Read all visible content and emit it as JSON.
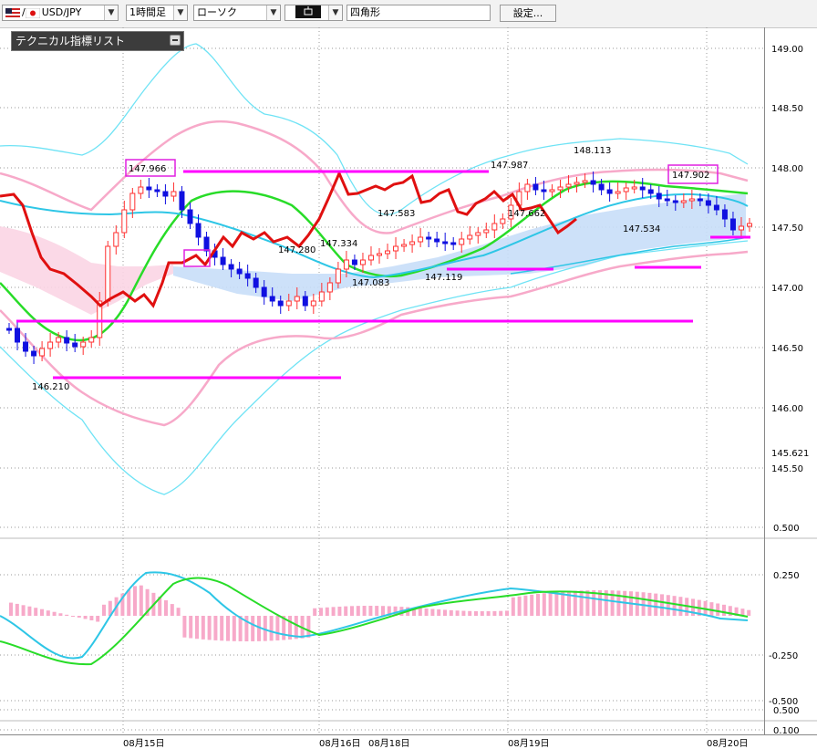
{
  "toolbar": {
    "symbol": "USD/JPY",
    "timeframe": "1時間足",
    "chart_type": "ローソク",
    "draw_tool_icon": "rectangle-icon",
    "shape_name": "四角形",
    "settings_label": "設定..."
  },
  "indicator_list": {
    "title": "テクニカル指標リスト"
  },
  "price_axis": {
    "labels": [
      "149.00",
      "148.50",
      "148.00",
      "147.50",
      "147.00",
      "146.50",
      "146.00",
      "145.621",
      "145.50"
    ]
  },
  "macd_axis": {
    "labels": [
      "0.500",
      "0.250",
      "-0.250",
      "-0.500",
      "0.500",
      "0.100"
    ]
  },
  "time_axis": {
    "labels": [
      "08月15日",
      "08月16日",
      "08月18日",
      "08月19日",
      "08月20日"
    ]
  },
  "annotations": {
    "labels": [
      "147.966",
      "146.210",
      "147.280",
      "147.334",
      "147.083",
      "147.583",
      "147.119",
      "147.987",
      "147.662",
      "148.113",
      "147.534",
      "147.902"
    ]
  },
  "colors": {
    "bollinger_outer": "#6fe3f5",
    "bollinger_inner": "#f7a9c9",
    "moving_average": "#28dc28",
    "kijun": "#2ec6e6",
    "chikou": "#e01010",
    "cloud": "#c8def8",
    "cloud_pink": "#fbd5e4",
    "candle_up": "#ff3030",
    "candle_down": "#1010e0",
    "levels": "#ff00ff"
  },
  "chart_data": {
    "type": "candlestick",
    "symbol": "USD/JPY",
    "timeframe": "1時間足",
    "price_ylim": [
      145.5,
      149.0
    ],
    "macd_ylim": [
      -0.5,
      0.5
    ],
    "categories": [
      "08月15日",
      "08月16日",
      "08月18日",
      "08月19日",
      "08月20日"
    ],
    "price_annotations": [
      147.966,
      146.21,
      147.28,
      147.334,
      147.083,
      147.583,
      147.119,
      147.987,
      147.662,
      148.113,
      147.534,
      147.902
    ],
    "last_price": 145.621,
    "grid": true,
    "legend": "none"
  }
}
